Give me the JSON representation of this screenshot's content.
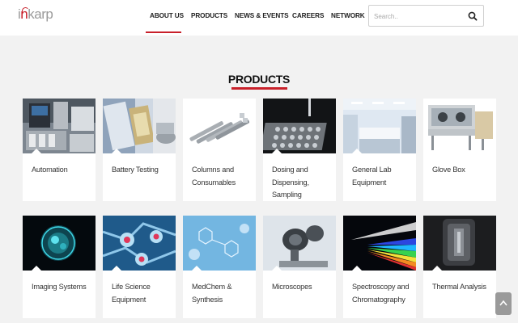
{
  "header": {
    "logo_text_pre": "i",
    "logo_text_accent": "n",
    "logo_text_post": "karp",
    "nav": [
      {
        "label": "ABOUT US",
        "active": true
      },
      {
        "label": "PRODUCTS",
        "active": false
      },
      {
        "label": "NEWS & EVENTS",
        "active": false
      },
      {
        "label": "CAREERS",
        "active": false
      },
      {
        "label": "NETWORK",
        "active": false
      }
    ],
    "search_placeholder": "Search..",
    "search_icon": "search-icon"
  },
  "main": {
    "section_title": "PRODUCTS",
    "products": [
      {
        "label": "Automation",
        "icon": "automation-image"
      },
      {
        "label": "Battery Testing",
        "icon": "battery-testing-image"
      },
      {
        "label": "Columns and Consumables",
        "icon": "columns-image"
      },
      {
        "label": "Dosing and Dispensing, Sampling",
        "icon": "dosing-image"
      },
      {
        "label": "General Lab Equipment",
        "icon": "lab-equipment-image"
      },
      {
        "label": "Glove Box",
        "icon": "glove-box-image"
      },
      {
        "label": "Imaging Systems",
        "icon": "imaging-image"
      },
      {
        "label": "Life Science Equipment",
        "icon": "life-science-image"
      },
      {
        "label": "MedChem & Synthesis",
        "icon": "medchem-image"
      },
      {
        "label": "Microscopes",
        "icon": "microscope-image"
      },
      {
        "label": "Spectroscopy and Chromatography",
        "icon": "spectroscopy-image"
      },
      {
        "label": "Thermal Analysis",
        "icon": "thermal-image"
      }
    ]
  },
  "colors": {
    "accent": "#c8202a",
    "page_bg": "#f2f2f2",
    "card_bg": "#ffffff"
  }
}
